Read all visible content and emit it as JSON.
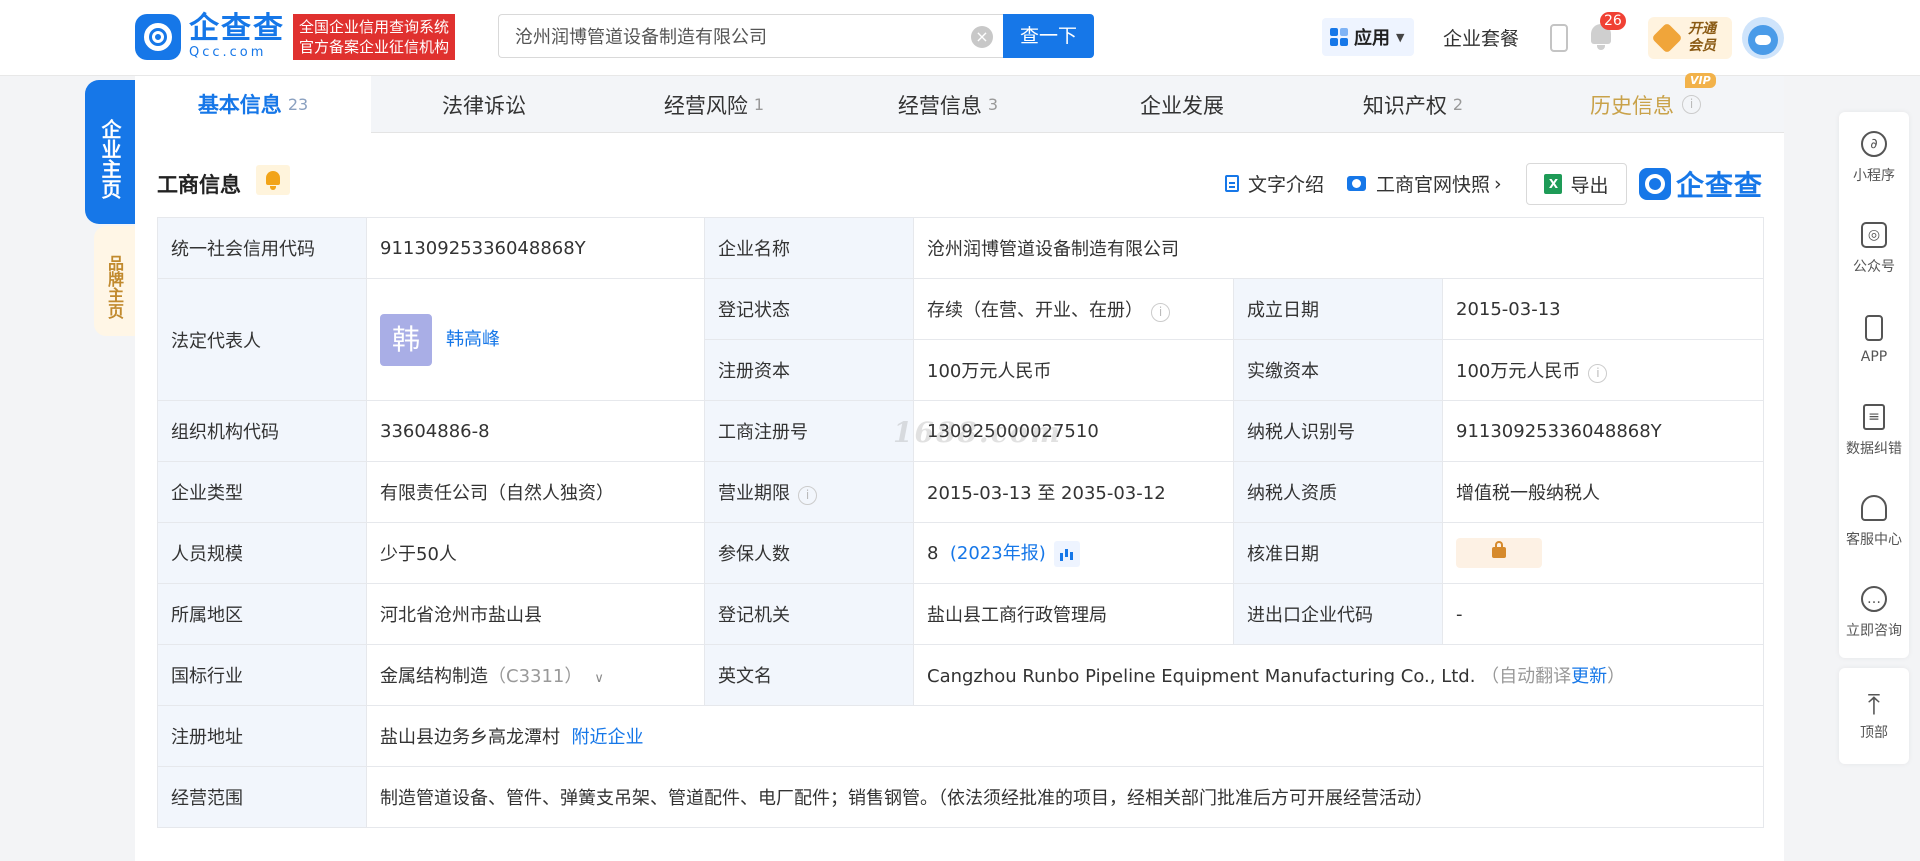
{
  "header": {
    "logo_cn": "企查查",
    "logo_en": "Qcc.com",
    "badge_line1": "全国企业信用查询系统",
    "badge_line2": "官方备案企业征信机构",
    "search_value": "沧州润博管道设备制造有限公司",
    "search_button": "查一下",
    "app_menu": "应用",
    "package_link": "企业套餐",
    "notification_count": "26",
    "vip_line1": "开通",
    "vip_line2": "会员"
  },
  "left_tabs": {
    "main": "企业主页",
    "brand": "品牌主页"
  },
  "tabs": [
    {
      "label": "基本信息",
      "count": "23"
    },
    {
      "label": "法律诉讼",
      "count": ""
    },
    {
      "label": "经营风险",
      "count": "1"
    },
    {
      "label": "经营信息",
      "count": "3"
    },
    {
      "label": "企业发展",
      "count": ""
    },
    {
      "label": "知识产权",
      "count": "2"
    },
    {
      "label": "历史信息",
      "count": "",
      "tag": "VIP"
    }
  ],
  "section": {
    "title": "工商信息",
    "text_intro": "文字介绍",
    "snapshot": "工商官网快照",
    "export": "导出",
    "brand": "企查查"
  },
  "table": {
    "credit_code_label": "统一社会信用代码",
    "credit_code": "91130925336048868Y",
    "company_name_label": "企业名称",
    "company_name": "沧州润博管道设备制造有限公司",
    "legal_rep_label": "法定代表人",
    "legal_rep_avatar": "韩",
    "legal_rep": "韩高峰",
    "status_label": "登记状态",
    "status": "存续（在营、开业、在册）",
    "founded_label": "成立日期",
    "founded": "2015-03-13",
    "reg_capital_label": "注册资本",
    "reg_capital": "100万元人民币",
    "paid_capital_label": "实缴资本",
    "paid_capital": "100万元人民币",
    "org_code_label": "组织机构代码",
    "org_code": "33604886-8",
    "reg_no_label": "工商注册号",
    "reg_no": "130925000027510",
    "taxpayer_id_label": "纳税人识别号",
    "taxpayer_id": "91130925336048868Y",
    "type_label": "企业类型",
    "type": "有限责任公司（自然人独资）",
    "term_label": "营业期限",
    "term": "2015-03-13 至 2035-03-12",
    "taxpayer_qual_label": "纳税人资质",
    "taxpayer_qual": "增值税一般纳税人",
    "staff_label": "人员规模",
    "staff": "少于50人",
    "insured_label": "参保人数",
    "insured": "8",
    "insured_year": "(2023年报)",
    "approve_label": "核准日期",
    "region_label": "所属地区",
    "region": "河北省沧州市盐山县",
    "authority_label": "登记机关",
    "authority": "盐山县工商行政管理局",
    "import_export_label": "进出口企业代码",
    "import_export": "-",
    "industry_label": "国标行业",
    "industry": "金属结构制造",
    "industry_code": "（C3311）",
    "english_name_label": "英文名",
    "english_name": "Cangzhou Runbo Pipeline Equipment Manufacturing Co., Ltd.",
    "auto_translate": "（自动翻译",
    "update_link": "更新",
    "close_paren": "）",
    "address_label": "注册地址",
    "address": "盐山县边务乡高龙潭村",
    "nearby_link": "附近企业",
    "scope_label": "经营范围",
    "scope": "制造管道设备、管件、弹簧支吊架、管道配件、电厂配件；销售钢管。（依法须经批准的项目，经相关部门批准后方可开展经营活动）"
  },
  "watermark": "1688.com",
  "rail": [
    "小程序",
    "公众号",
    "APP",
    "数据纠错",
    "客服中心",
    "立即咨询",
    "顶部"
  ],
  "colors": {
    "accent": "#1677e8",
    "label_bg": "#f2f6fc",
    "badge_red": "#e0312f",
    "vip_gold": "#c9a24a"
  }
}
